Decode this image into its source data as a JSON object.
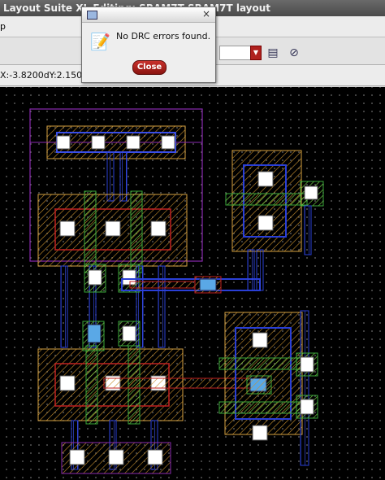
{
  "window": {
    "title": "Layout Suite XL Editing: SRAM7T SRAM7T layout"
  },
  "menubar": {
    "first_item": "p"
  },
  "statusbar": {
    "coords": "X:-3.8200dY:2.1500D"
  },
  "toolbar": {
    "icons": [
      "display-options-icon",
      "drc-markers-icon"
    ]
  },
  "dialog": {
    "message": "No DRC errors found.",
    "close_label": "Close",
    "icon": "info-note-icon",
    "close_glyph": "×"
  },
  "colors": {
    "canvas_bg": "#000000",
    "grid_dots": "#6a6a6a",
    "metal1": "#2a3fd6",
    "poly": "#3aa83a",
    "diffusion": "#b07030",
    "nwell": "#8a2ab0",
    "contact": "#ffffff",
    "via": "#5aa8e6",
    "accent_red": "#b0211e"
  }
}
